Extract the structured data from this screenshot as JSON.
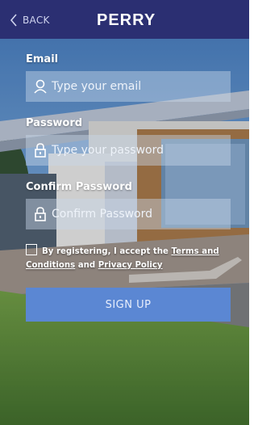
{
  "header": {
    "back_label": "BACK",
    "logo_text": "PERRY"
  },
  "form": {
    "email_label": "Email",
    "email_placeholder": "Type your email",
    "password_label": "Password",
    "password_placeholder": "Type your password",
    "confirm_label": "Confirm Password",
    "confirm_placeholder": "Confirm Password",
    "terms_prefix": "By registering, I accept the ",
    "terms_link1": "Terms and Conditions",
    "terms_mid": " and ",
    "terms_link2": "Privacy Policy",
    "signup_label": "SIGN UP"
  },
  "colors": {
    "header": "#2b2f72",
    "button": "#5b87d3"
  },
  "icons": [
    "chevron-left-icon",
    "user-icon",
    "lock-icon",
    "lock-icon"
  ]
}
